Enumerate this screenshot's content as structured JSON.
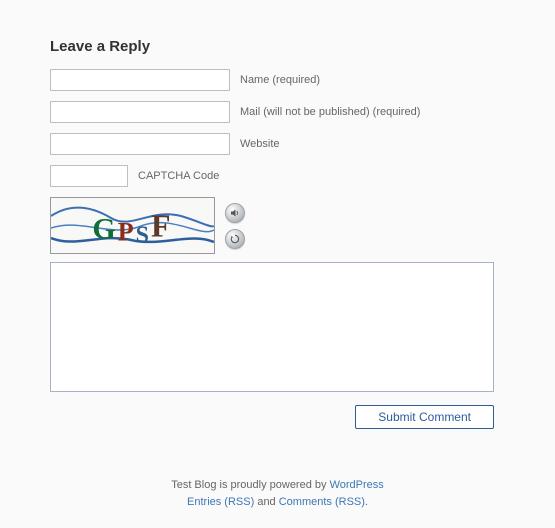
{
  "heading": "Leave a Reply",
  "fields": {
    "name": {
      "label": "Name (required)"
    },
    "mail": {
      "label": "Mail (will not be published) (required)"
    },
    "website": {
      "label": "Website"
    },
    "captcha": {
      "label": "CAPTCHA Code"
    }
  },
  "captcha_chars": [
    "G",
    "P",
    "S",
    "F"
  ],
  "submit_label": "Submit Comment",
  "footer": {
    "prefix": "Test Blog is proudly powered by ",
    "wp": "WordPress",
    "entries": "Entries (RSS)",
    "and": " and ",
    "comments": "Comments (RSS)",
    "suffix": "."
  }
}
